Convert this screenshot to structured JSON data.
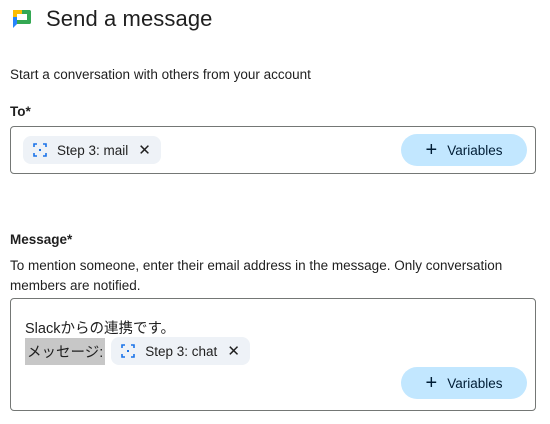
{
  "header": {
    "title": "Send a message",
    "logo_icon": "google-chat-icon"
  },
  "subtitle": "Start a conversation with others from your account",
  "to": {
    "label": "To*",
    "chip": {
      "text": "Step 3: mail",
      "icon": "variable-icon"
    },
    "variables_button": "Variables"
  },
  "message": {
    "label": "Message*",
    "hint": "To mention someone, enter their email address in the message. Only conversation members are notified.",
    "line1": "Slackからの連携です。",
    "selected_text": "メッセージ:",
    "chip": {
      "text": "Step 3: chat",
      "icon": "variable-icon"
    },
    "variables_button": "Variables"
  },
  "colors": {
    "chip_bg": "#eef2f7",
    "button_bg": "#c2e7ff",
    "selection_bg": "#c7c7c7",
    "border": "#747775"
  }
}
